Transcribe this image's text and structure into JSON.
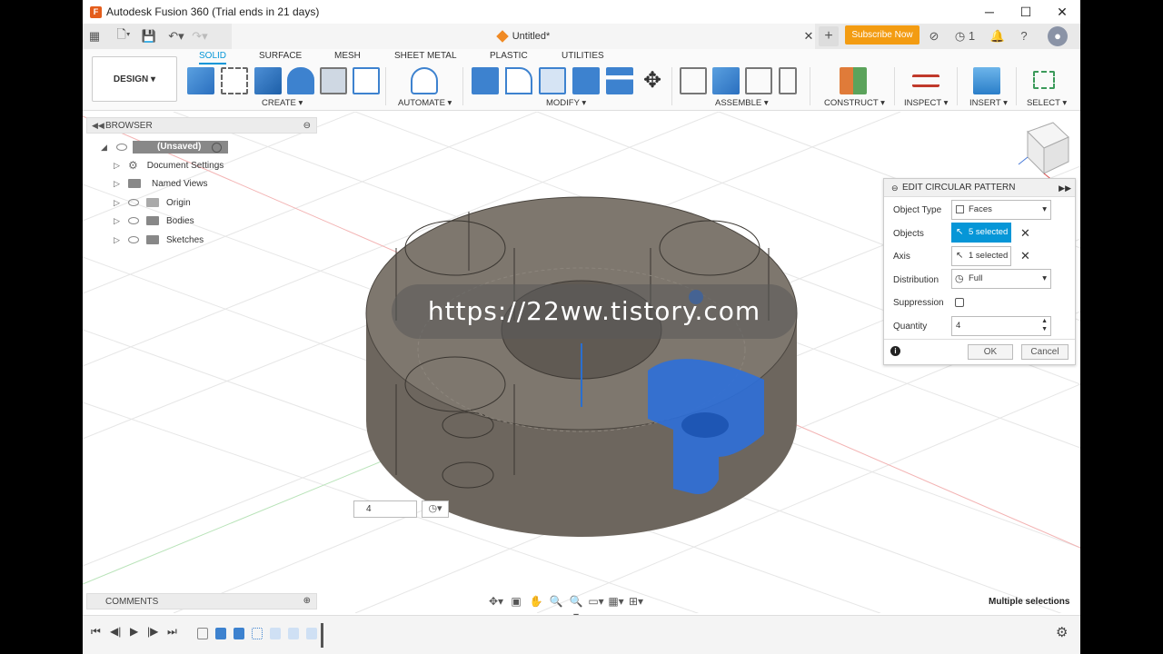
{
  "window": {
    "title": "Autodesk Fusion 360 (Trial ends in 21 days)",
    "controls": [
      "─",
      "☐",
      "✕"
    ]
  },
  "tabbar": {
    "doc_title": "Untitled*",
    "close": "✕",
    "new_tab": "+",
    "subscribe": "Subscribe Now",
    "jobs_count": "1"
  },
  "toolbar": {
    "design_label": "DESIGN ▾",
    "tabs": [
      "SOLID",
      "SURFACE",
      "MESH",
      "SHEET METAL",
      "PLASTIC",
      "UTILITIES"
    ],
    "groups": [
      "CREATE ▾",
      "AUTOMATE ▾",
      "MODIFY ▾",
      "ASSEMBLE ▾",
      "CONSTRUCT ▾",
      "INSPECT ▾",
      "INSERT ▾",
      "SELECT ▾"
    ]
  },
  "browser": {
    "title": "BROWSER",
    "root": "(Unsaved)",
    "items": [
      "Document Settings",
      "Named Views",
      "Origin",
      "Bodies",
      "Sketches"
    ]
  },
  "edit_panel": {
    "title": "EDIT CIRCULAR PATTERN",
    "object_type_label": "Object Type",
    "object_type_value": "Faces",
    "objects_label": "Objects",
    "objects_value": "5 selected",
    "axis_label": "Axis",
    "axis_value": "1 selected",
    "distribution_label": "Distribution",
    "distribution_value": "Full",
    "suppression_label": "Suppression",
    "quantity_label": "Quantity",
    "quantity_value": "4",
    "ok": "OK",
    "cancel": "Cancel",
    "accent": "#0696d7"
  },
  "viewport": {
    "quantity_input": "4",
    "watermark": "https://22ww.tistory.com"
  },
  "comments": {
    "title": "COMMENTS"
  },
  "status": {
    "selection": "Multiple selections"
  }
}
